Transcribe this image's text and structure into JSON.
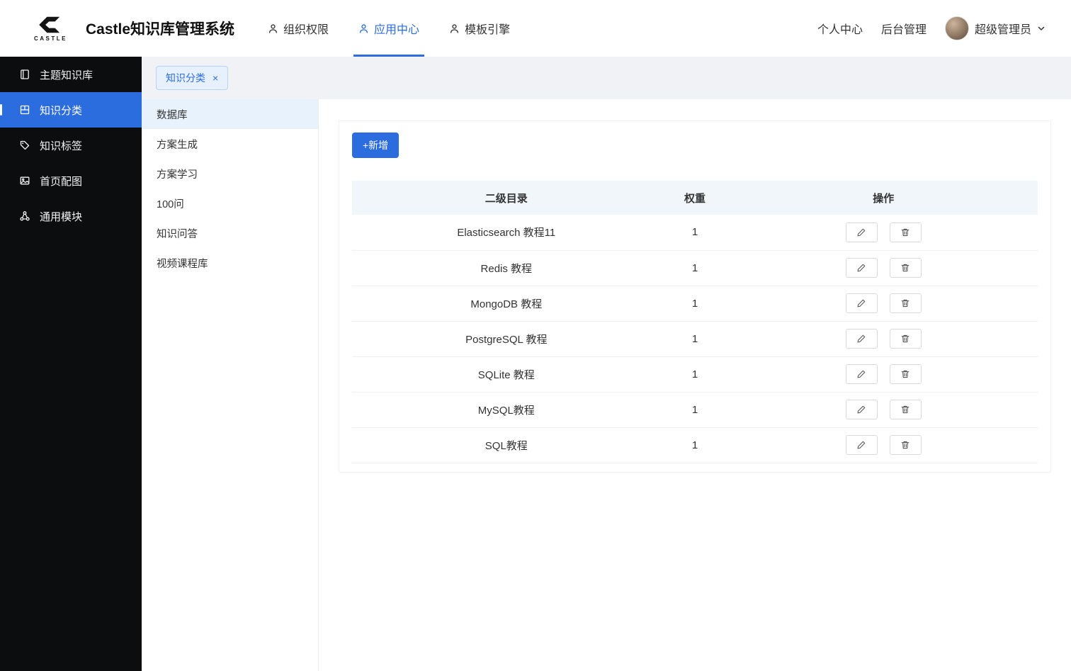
{
  "header": {
    "logo_text": "CASTLE",
    "title": "Castle知识库管理系统",
    "nav": [
      {
        "label": "组织权限"
      },
      {
        "label": "应用中心"
      },
      {
        "label": "模板引擎"
      }
    ],
    "personal_center": "个人中心",
    "backend_admin": "后台管理",
    "username": "超级管理员"
  },
  "sidebar": {
    "items": [
      {
        "label": "主题知识库"
      },
      {
        "label": "知识分类"
      },
      {
        "label": "知识标签"
      },
      {
        "label": "首页配图"
      },
      {
        "label": "通用模块"
      }
    ]
  },
  "tabbar": {
    "tabs": [
      {
        "label": "知识分类",
        "close": "×"
      }
    ]
  },
  "submenu": {
    "items": [
      {
        "label": "数据库"
      },
      {
        "label": "方案生成"
      },
      {
        "label": "方案学习"
      },
      {
        "label": "100问"
      },
      {
        "label": "知识问答"
      },
      {
        "label": "视频课程库"
      }
    ]
  },
  "main": {
    "add_button_label": "+新增",
    "table": {
      "headers": {
        "name": "二级目录",
        "weight": "权重",
        "actions": "操作"
      },
      "rows": [
        {
          "name": "Elasticsearch 教程11",
          "weight": "1"
        },
        {
          "name": "Redis 教程",
          "weight": "1"
        },
        {
          "name": "MongoDB 教程",
          "weight": "1"
        },
        {
          "name": "PostgreSQL 教程",
          "weight": "1"
        },
        {
          "name": "SQLite 教程",
          "weight": "1"
        },
        {
          "name": "MySQL教程",
          "weight": "1"
        },
        {
          "name": "SQL教程",
          "weight": "1"
        }
      ]
    }
  },
  "colors": {
    "primary": "#2b6cdf",
    "sidebar_bg": "#0c0d0f",
    "tab_chip_bg": "#e7f0fd",
    "table_header_bg": "#f1f6fb"
  }
}
